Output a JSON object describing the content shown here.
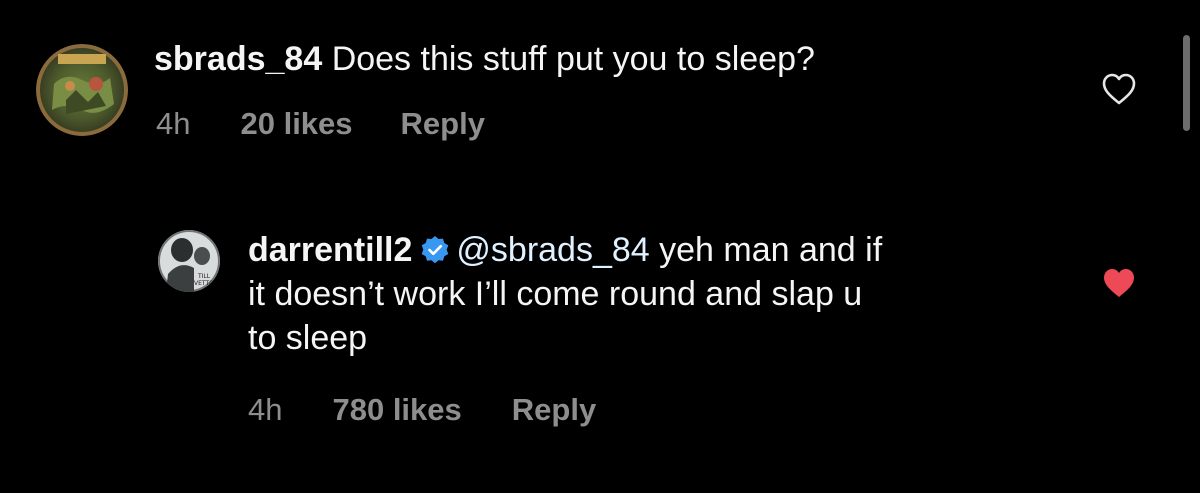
{
  "comments": [
    {
      "username": "sbrads_84",
      "text": "Does this stuff put you to sleep?",
      "time": "4h",
      "likes": "20 likes",
      "reply_label": "Reply",
      "liked": false
    },
    {
      "username": "darrentill2",
      "verified": true,
      "mention": "@sbrads_84",
      "text_line1": "yeh man and if",
      "text_line2": "it doesn’t work I’ll come round and slap u",
      "text_line3": "to sleep",
      "time": "4h",
      "likes": "780 likes",
      "reply_label": "Reply",
      "liked": true,
      "avatar_text": "TILL VETTORI"
    }
  ],
  "colors": {
    "background": "#000000",
    "text": "#f5f5f5",
    "muted": "#8e8e8e",
    "mention": "#e0f1ff",
    "heart_liked": "#ed4956",
    "verified": "#3897f0"
  },
  "icons": {
    "heart_outline": "heart-outline-icon",
    "heart_filled": "heart-filled-icon",
    "verified": "verified-badge-icon"
  }
}
